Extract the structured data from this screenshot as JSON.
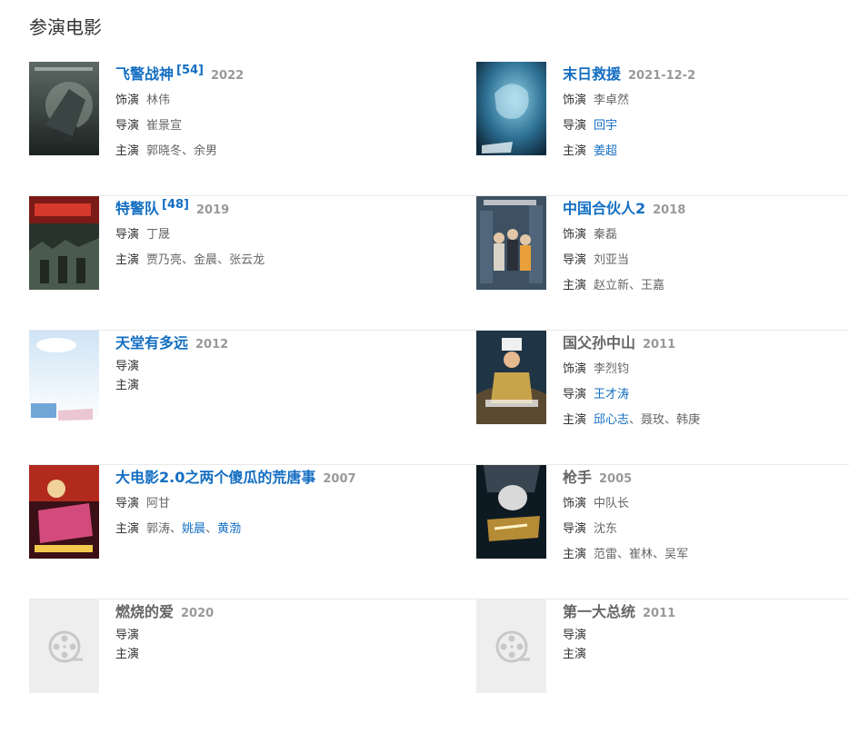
{
  "section": {
    "title": "参演电影"
  },
  "labels": {
    "role": "饰演",
    "director": "导演",
    "starring": "主演"
  },
  "films": [
    {
      "title": "飞警战神",
      "ref": "[54]",
      "year": "2022",
      "role": "林伟",
      "director": "崔景宣",
      "cast": [
        "郭晓冬",
        "余男"
      ],
      "poster": "poster-feijing"
    },
    {
      "title": "末日救援",
      "year": "2021-12-2",
      "role": "李卓然",
      "director": "回宇",
      "director_link": true,
      "cast": [
        "姜超"
      ],
      "cast_links": [
        true
      ],
      "poster": "poster-mori"
    },
    {
      "title": "特警队",
      "ref": "[48]",
      "year": "2019",
      "director": "丁晟",
      "cast": [
        "贾乃亮",
        "金晨",
        "张云龙"
      ],
      "poster": "poster-tejing"
    },
    {
      "title": "中国合伙人2",
      "year": "2018",
      "role": "秦磊",
      "director": "刘亚当",
      "cast": [
        "赵立新",
        "王嘉"
      ],
      "poster": "poster-hehuoren"
    },
    {
      "title": "天堂有多远",
      "year": "2012",
      "director": "",
      "cast": [],
      "poster": "poster-tiantang"
    },
    {
      "title": "国父孙中山",
      "title_plain": true,
      "year": "2011",
      "role": "李烈钧",
      "director": "王才涛",
      "director_link": true,
      "cast": [
        "邱心志",
        "聂玫",
        "韩庚"
      ],
      "cast_links": [
        true,
        false,
        false
      ],
      "poster": "poster-guofu"
    },
    {
      "title": "大电影2.0之两个傻瓜的荒唐事",
      "year": "2007",
      "director": "阿甘",
      "cast": [
        "郭涛",
        "姚晨",
        "黄渤"
      ],
      "cast_links": [
        false,
        true,
        true
      ],
      "poster": "poster-dadianying"
    },
    {
      "title": "枪手",
      "title_plain": true,
      "year": "2005",
      "role": "中队长",
      "director": "沈东",
      "cast": [
        "范雷",
        "崔林",
        "吴军"
      ],
      "poster": "poster-qiangshou"
    },
    {
      "title": "燃烧的爱",
      "title_plain": true,
      "year": "2020",
      "director": "",
      "cast": [],
      "poster": "film-reel-icon"
    },
    {
      "title": "第一大总统",
      "title_plain": true,
      "year": "2011",
      "director": "",
      "cast": [],
      "poster": "film-reel-icon"
    }
  ],
  "colors": {
    "link": "#136ec2",
    "muted": "#999999",
    "text": "#333333",
    "placeholder_bg": "#eeeeee"
  }
}
